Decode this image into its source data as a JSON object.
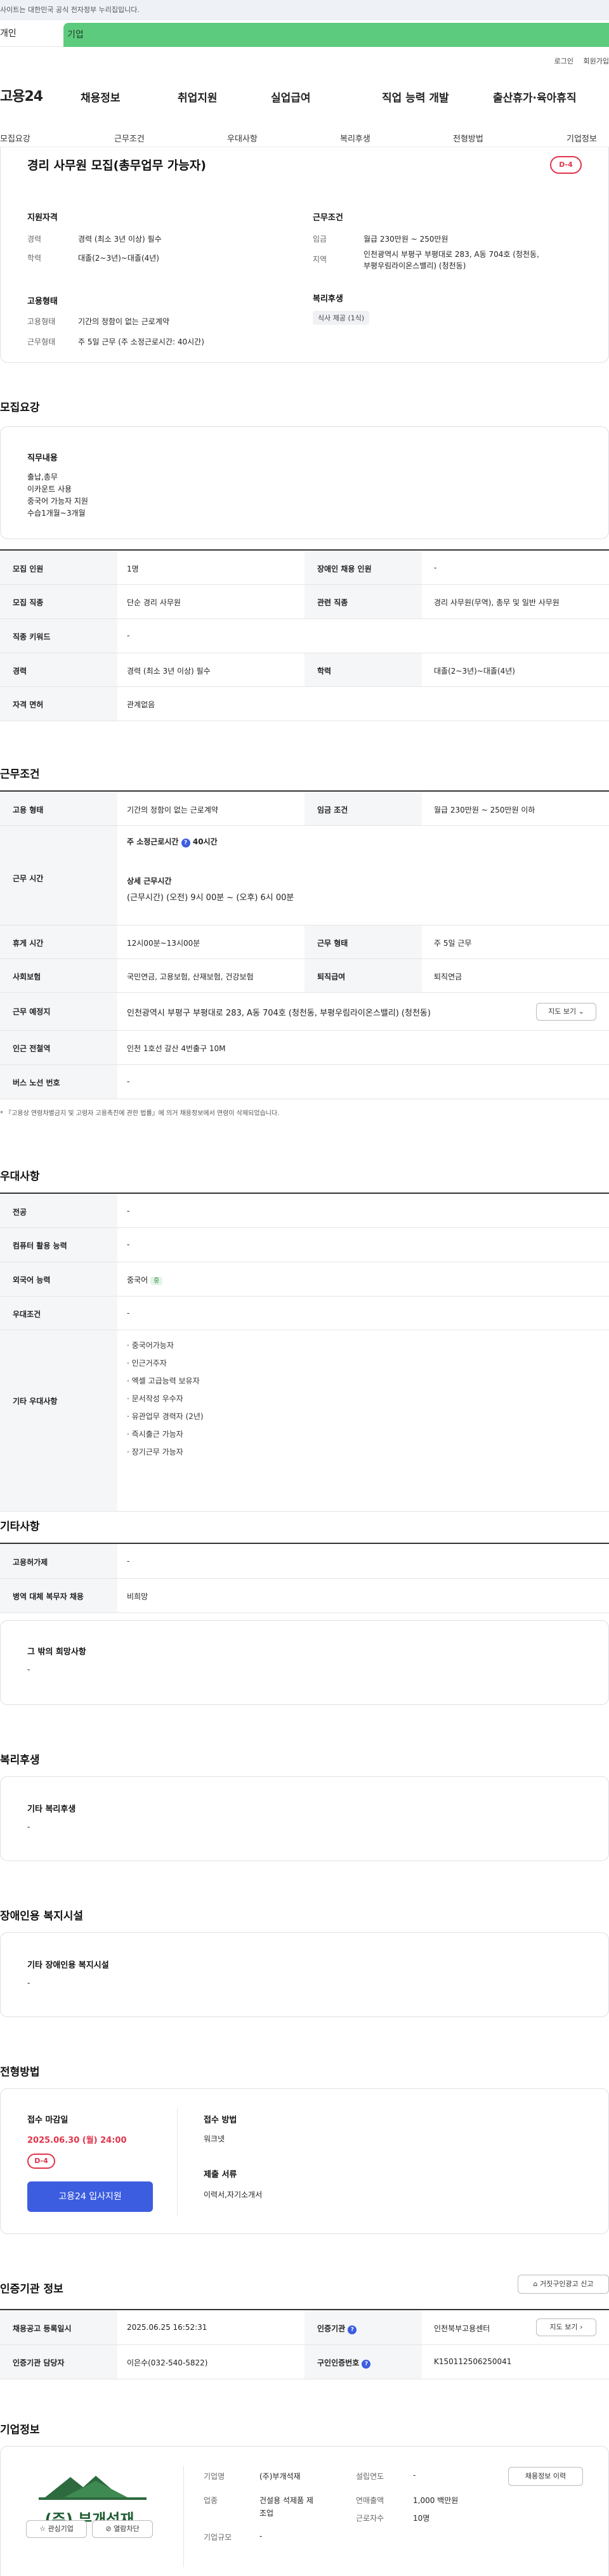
{
  "notice": "사이트는 대한민국 공식 전자정부 누리집입니다.",
  "tabs": {
    "personal": "개인",
    "company": "기업"
  },
  "util": {
    "login": "로그인",
    "join": "회원가입"
  },
  "logo": "고용24",
  "gnb": [
    "채용정보",
    "취업지원",
    "실업급여",
    "직업 능력 개발",
    "출산휴가·육아휴직"
  ],
  "subnav": [
    "모집요강",
    "근무조건",
    "우대사항",
    "복리후생",
    "전형방법",
    "기업정보"
  ],
  "summary": {
    "title": "경리 사무원 모집(총무업무 가능자)",
    "dday": "D-4",
    "qual_title": "지원자격",
    "qual_career_label": "경력",
    "qual_career": "경력 (최소 3년 이상) 필수",
    "qual_edu_label": "학력",
    "qual_edu": "대졸(2~3년)~대졸(4년)",
    "cond_title": "근무조건",
    "cond_wage_label": "임금",
    "cond_wage": "월급 230만원 ~ 250만원",
    "cond_area_label": "지역",
    "cond_area1": "인천광역시 부평구 부평대로 283, A동 704호 (청천동,",
    "cond_area2": "부평우림라이온스밸리) (청천동)",
    "emp_title": "고용형태",
    "emp_type_label": "고용형태",
    "emp_type": "기간의 정함이 없는 근로계약",
    "emp_form_label": "근무형태",
    "emp_form": "주 5일 근무 (주 소정근로시간: 40시간)",
    "welfare_title": "복리후생",
    "welfare_tag": "식사 제공 (1식)"
  },
  "recruit": {
    "heading": "모집요강",
    "duty_title": "직무내용",
    "duty_lines": [
      "출납,총무",
      "이카운트 사용",
      "중국어 가능자 지원",
      "수습1개월~3개월"
    ],
    "rows": [
      {
        "l1": "모집 인원",
        "v1": "1명",
        "l2": "장애인 채용 인원",
        "v2": "-"
      },
      {
        "l1": "모집 직종",
        "v1": "단순 경리 사무원",
        "l2": "관련 직종",
        "v2": "경리 사무원(무역), 총무 및 일반 사무원"
      },
      {
        "l1": "직종 키워드",
        "v1": "-"
      },
      {
        "l1": "경력",
        "v1": "경력 (최소 3년 이상) 필수",
        "l2": "학력",
        "v2": "대졸(2~3년)~대졸(4년)"
      },
      {
        "l1": "자격 면허",
        "v1": "관계없음"
      }
    ]
  },
  "work": {
    "heading": "근무조건",
    "type_label": "고용 형태",
    "type": "기간의 정함이 없는 근로계약",
    "wage_label": "임금 조건",
    "wage": "월급 230만원 ~ 250만원 이하",
    "hours_label": "근무 시간",
    "hours_week_title": "주 소정근로시간",
    "hours_week": "40시간",
    "hours_detail_title": "상세 근무시간",
    "hours_detail": "(근무시간) (오전) 9시 00분 ~ (오후) 6시 00분",
    "rest_label": "휴게 시간",
    "rest": "12시00분~13시00분",
    "form_label": "근무 형태",
    "form": "주 5일 근무",
    "ins_label": "사회보험",
    "ins": "국민연금, 고용보험, 산재보험, 건강보험",
    "retire_label": "퇴직급여",
    "retire": "퇴직연금",
    "place_label": "근무 예정지",
    "place": "인천광역시 부평구 부평대로 283, A동 704호 (청천동, 부평우림라이온스밸리) (청천동)",
    "map_btn": "지도 보기",
    "subway_label": "인근 전철역",
    "subway": "인천 1호선 갈산 4번출구 10M",
    "bus_label": "버스 노선 번호",
    "bus": "-",
    "footnote": "* 『고용상 연령차별금지 및 고령자 고용촉진에 관한 법률』에 의거 채용정보에서 연령이 삭제되었습니다."
  },
  "pref": {
    "heading": "우대사항",
    "major_label": "전공",
    "major": "-",
    "pc_label": "컴퓨터 활용 능력",
    "pc": "-",
    "lang_label": "외국어 능력",
    "lang": "중국어",
    "lang_badge": "중",
    "cond_label": "우대조건",
    "cond": "-",
    "etc_label": "기타 우대사항",
    "etc": [
      "· 중국어가능자",
      "· 인근거주자",
      "· 엑셀 고급능력 보유자",
      "· 문서작성 우수자",
      "· 유관업무 경력자 (2년)",
      "· 즉시출근 가능자",
      "· 장기근무 가능자"
    ]
  },
  "other": {
    "heading": "기타사항",
    "apply_label": "고용허가제",
    "apply": "-",
    "mil_label": "병역 대체 복무자 채용",
    "mil": "비희망",
    "hope_title": "그 밖의 희망사항",
    "hope": "-"
  },
  "welfare": {
    "heading": "복리후생",
    "title": "기타 복리후생",
    "value": "-"
  },
  "disabled": {
    "heading": "장애인용 복지시설",
    "title": "기타 장애인용 복지시설",
    "value": "-"
  },
  "process": {
    "heading": "전형방법",
    "deadline_title": "접수 마감일",
    "deadline": "2025.06.30 (월) 24:00",
    "dday": "D-4",
    "apply_btn": "고용24 입사지원",
    "method_title": "접수 방법",
    "method": "워크넷",
    "docs_title": "제출 서류",
    "docs": "이력서,자기소개서"
  },
  "cert": {
    "heading": "인증기관 정보",
    "report_btn": "거짓구인광고 신고",
    "reg_label": "채용공고 등록일시",
    "reg": "2025.06.25 16:52:31",
    "org_label": "인증기관",
    "org": "인천북부고용센터",
    "map_btn": "지도 보기",
    "mgr_label": "인증기관 담당자",
    "mgr": "이은수(032-540-5822)",
    "no_label": "구인인증번호",
    "no": "K150112506250041"
  },
  "company": {
    "heading": "기업정보",
    "logo_text": "(주) 부개석재",
    "fav_btn": "관심기업",
    "block_btn": "열람차단",
    "name_label": "기업명",
    "name": "(주)부개석재",
    "year_label": "설립연도",
    "year": "-",
    "ind_label": "업종",
    "ind1": "건설용 석제품 제",
    "ind2": "조업",
    "sales_label": "연매출액",
    "sales": "1,000 백만원",
    "emp_label": "근로자수",
    "emp": "10명",
    "size_label": "기업규모",
    "size": "-",
    "jobs_btn": "채용정보 이력"
  }
}
